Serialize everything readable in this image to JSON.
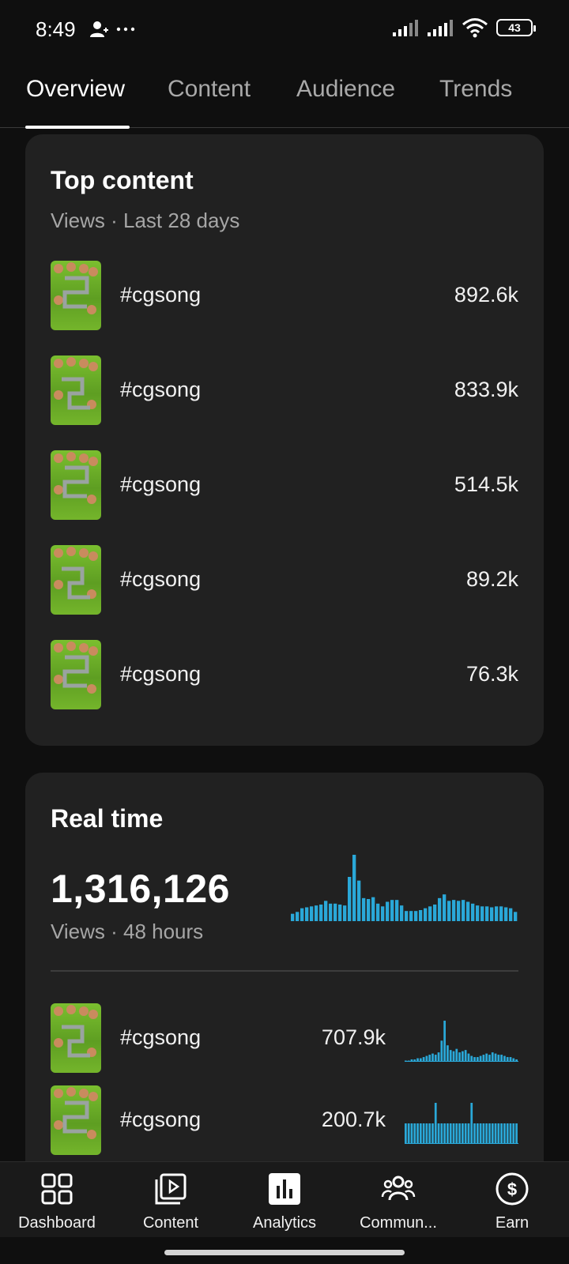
{
  "status": {
    "time": "8:49",
    "battery": "43"
  },
  "tabs": [
    {
      "label": "Overview",
      "active": true
    },
    {
      "label": "Content",
      "active": false
    },
    {
      "label": "Audience",
      "active": false
    },
    {
      "label": "Trends",
      "active": false
    }
  ],
  "top_content": {
    "title": "Top content",
    "subtitle": "Views · Last 28 days",
    "items": [
      {
        "title": "#cgsong",
        "value": "892.6k"
      },
      {
        "title": "#cgsong",
        "value": "833.9k"
      },
      {
        "title": "#cgsong",
        "value": "514.5k"
      },
      {
        "title": "#cgsong",
        "value": "89.2k"
      },
      {
        "title": "#cgsong",
        "value": "76.3k"
      }
    ]
  },
  "real_time": {
    "title": "Real time",
    "total": "1,316,126",
    "subtitle": "Views · 48 hours",
    "items": [
      {
        "title": "#cgsong",
        "value": "707.9k"
      },
      {
        "title": "#cgsong",
        "value": "200.7k"
      }
    ]
  },
  "chart_data": [
    {
      "type": "bar",
      "values": [
        8,
        10,
        14,
        15,
        16,
        17,
        18,
        22,
        19,
        19,
        18,
        17,
        48,
        72,
        44,
        25,
        24,
        26,
        19,
        16,
        21,
        23,
        23,
        17,
        11,
        11,
        11,
        12,
        14,
        16,
        18,
        25,
        29,
        22,
        23,
        22,
        23,
        21,
        19,
        17,
        16,
        16,
        15,
        16,
        16,
        15,
        14,
        10
      ]
    },
    {
      "type": "bar",
      "values": [
        1,
        1,
        2,
        2,
        3,
        3,
        4,
        5,
        6,
        7,
        6,
        8,
        18,
        35,
        14,
        10,
        9,
        11,
        8,
        9,
        10,
        7,
        5,
        4,
        4,
        5,
        6,
        7,
        6,
        8,
        7,
        6,
        6,
        5,
        4,
        4,
        3,
        2
      ]
    },
    {
      "type": "bar",
      "values": [
        1,
        1,
        1,
        1,
        1,
        1,
        1,
        1,
        1,
        1,
        2,
        1,
        1,
        1,
        1,
        1,
        1,
        1,
        1,
        1,
        1,
        1,
        2,
        1,
        1,
        1,
        1,
        1,
        1,
        1,
        1,
        1,
        1,
        1,
        1,
        1,
        1,
        1
      ]
    }
  ],
  "bottom_nav": [
    {
      "label": "Dashboard",
      "icon": "dashboard-icon"
    },
    {
      "label": "Content",
      "icon": "content-icon"
    },
    {
      "label": "Analytics",
      "icon": "analytics-icon",
      "active": true
    },
    {
      "label": "Commun...",
      "icon": "community-icon"
    },
    {
      "label": "Earn",
      "icon": "earn-icon"
    }
  ],
  "colors": {
    "accent_bar": "#2aa8d8",
    "background": "#0f0f0f",
    "card": "#212121"
  }
}
